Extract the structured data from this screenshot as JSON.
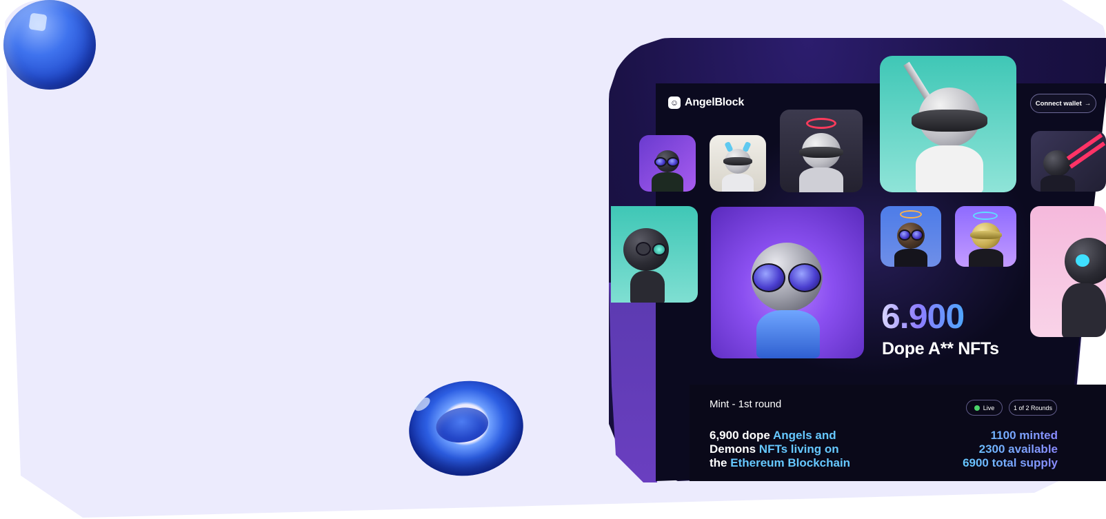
{
  "brand": {
    "name": "AngelBlock",
    "icon": "smiley-logo-icon"
  },
  "header": {
    "connect_label": "Connect wallet",
    "connect_arrow": "→"
  },
  "hero": {
    "count": "6.900",
    "label": "Dope A** NFTs"
  },
  "mint": {
    "title": "Mint - 1st round",
    "status": "Live",
    "status_color": "#4bd46a",
    "rounds": "1 of 2 Rounds",
    "description_parts": [
      {
        "text": "6,900 dope ",
        "color": "white"
      },
      {
        "text": "Angels and",
        "color": "cyan"
      },
      {
        "text": "Demons ",
        "color": "white"
      },
      {
        "text": "NFTs living on",
        "color": "cyan"
      },
      {
        "text": "the ",
        "color": "white"
      },
      {
        "text": "Ethereum Blockchain",
        "color": "cyan"
      }
    ],
    "stats": [
      "1100 minted",
      "2300 available",
      "6900 total supply"
    ]
  },
  "colors": {
    "page_bg": "#ecebfd",
    "app_bg": "#0b0a1f",
    "accent_cyan": "#66c8ff",
    "accent_purple": "#8e7dff"
  }
}
